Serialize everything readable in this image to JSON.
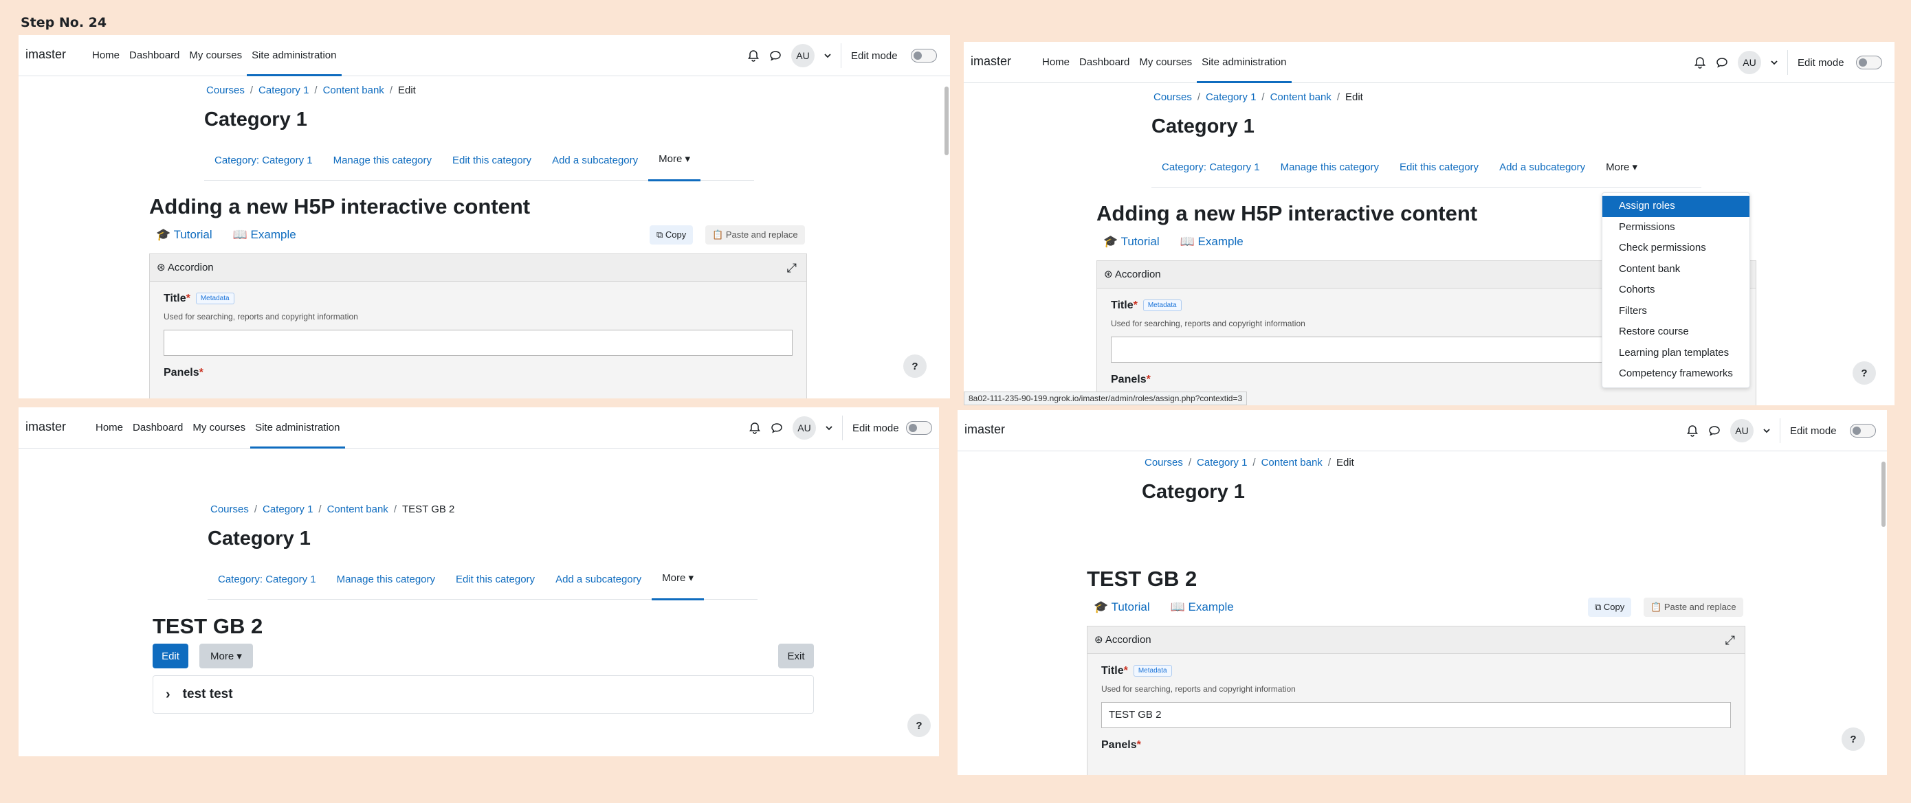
{
  "step_label": "Step No. 24",
  "nav": {
    "brand": "imaster",
    "links": [
      "Home",
      "Dashboard",
      "My courses",
      "Site administration"
    ],
    "avatar": "AU",
    "edit_mode": "Edit mode"
  },
  "breadcrumb": {
    "courses": "Courses",
    "category": "Category 1",
    "content_bank": "Content bank",
    "edit": "Edit",
    "item": "TEST GB 2"
  },
  "page_title": "Category 1",
  "subnav": {
    "category": "Category: Category 1",
    "manage": "Manage this category",
    "edit": "Edit this category",
    "add": "Add a subcategory",
    "more": "More"
  },
  "h5p": {
    "heading": "Adding a new H5P interactive content",
    "tutorial": "Tutorial",
    "example": "Example",
    "copy": "Copy",
    "paste": "Paste and replace",
    "library": "Accordion",
    "title_label": "Title",
    "metadata": "Metadata",
    "title_desc": "Used for searching, reports and copyright information",
    "panels_label": "Panels",
    "title_value": "TEST GB 2"
  },
  "more_menu": [
    "Assign roles",
    "Permissions",
    "Check permissions",
    "Content bank",
    "Cohorts",
    "Filters",
    "Restore course",
    "Learning plan templates",
    "Competency frameworks"
  ],
  "status_url": "8a02-111-235-90-199.ngrok.io/imaster/admin/roles/assign.php?contextid=3",
  "view": {
    "heading": "TEST GB 2",
    "edit_btn": "Edit",
    "more_btn": "More",
    "exit_btn": "Exit",
    "item": "test test"
  },
  "help": "?",
  "icons": [
    "bell-icon",
    "chat-icon",
    "chevron-down-icon",
    "graduation-cap-icon",
    "book-icon",
    "copy-icon",
    "paste-icon",
    "h5p-icon",
    "expand-icon",
    "chevron-right-icon"
  ]
}
